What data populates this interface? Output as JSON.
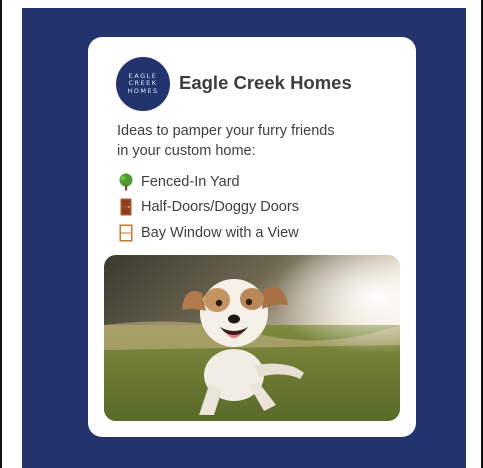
{
  "brand": {
    "logo_line1": "EAGLE",
    "logo_line2": "CREEK",
    "logo_line3": "HOMES",
    "name": "Eagle Creek Homes"
  },
  "post": {
    "intro": "Ideas to pamper your furry friends in your custom home:",
    "items": [
      {
        "icon": "tree-icon",
        "label": "Fenced-In Yard"
      },
      {
        "icon": "door-icon",
        "label": "Half-Doors/Doggy Doors"
      },
      {
        "icon": "window-icon",
        "label": "Bay Window with a View"
      }
    ],
    "photo": "dog-running-photo"
  },
  "colors": {
    "background": "#22336d",
    "card": "#ffffff",
    "text": "#3f3f3f"
  }
}
